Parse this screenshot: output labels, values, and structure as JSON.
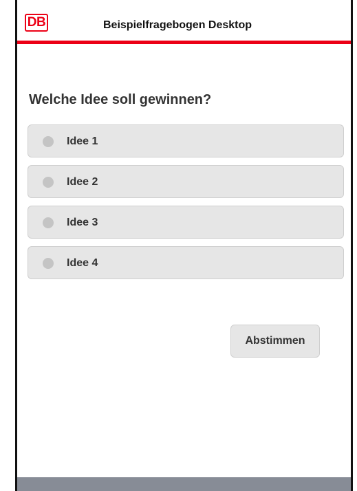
{
  "header": {
    "logo_text": "DB",
    "title": "Beispielfragebogen Desktop"
  },
  "question": "Welche Idee soll gewinnen?",
  "options": [
    {
      "label": "Idee 1"
    },
    {
      "label": "Idee 2"
    },
    {
      "label": "Idee 3"
    },
    {
      "label": "Idee 4"
    }
  ],
  "submit_label": "Abstimmen",
  "colors": {
    "brand": "#ec0016",
    "option_bg": "#e6e6e6",
    "footer": "#878c96"
  }
}
